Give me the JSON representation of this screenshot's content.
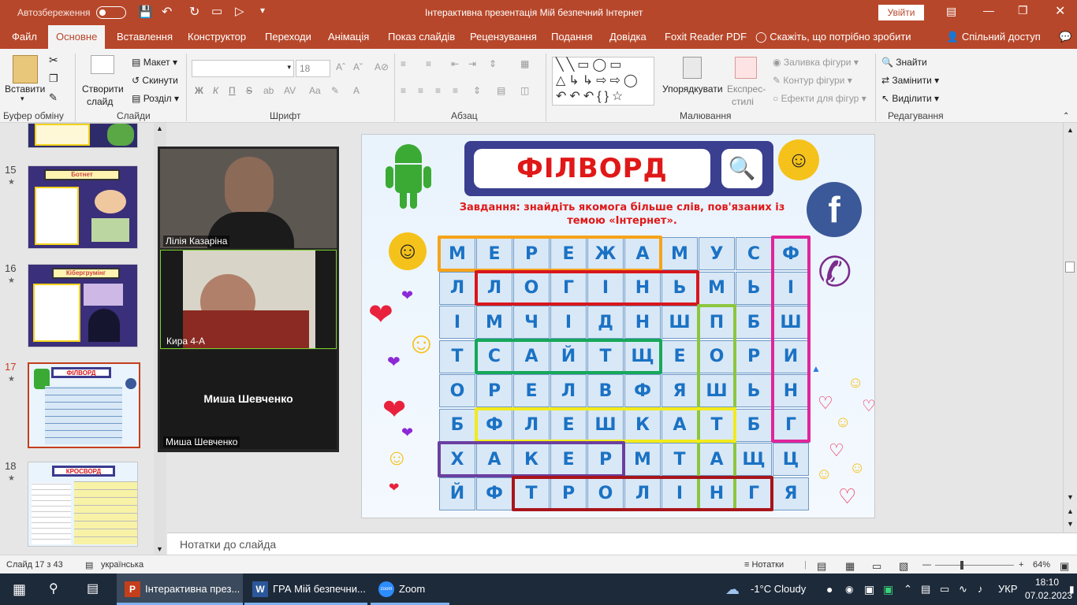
{
  "titlebar": {
    "autosave": "Автозбереження",
    "title": "Інтерактивна презентація Мій безпечний Інтернет",
    "signin": "Увійти"
  },
  "tabs": [
    "Файл",
    "Основне",
    "Вставлення",
    "Конструктор",
    "Переходи",
    "Анімація",
    "Показ слайдів",
    "Рецензування",
    "Подання",
    "Довідка",
    "Foxit Reader PDF"
  ],
  "tell_me": "Скажіть, що потрібно зробити",
  "share": "Спільний доступ",
  "ribbon": {
    "paste": "Вставити",
    "clipboard": "Буфер обміну",
    "new_slide": "Створити",
    "new_slide2": "слайд",
    "layout": "Макет",
    "reset": "Скинути",
    "section": "Розділ",
    "slides": "Слайди",
    "font_size": "18",
    "font": "Шрифт",
    "bold": "Ж",
    "italic": "К",
    "underline": "П",
    "strike": "S",
    "paragraph": "Абзац",
    "arrange": "Упорядкувати",
    "quick_styles": "Експрес-",
    "quick_styles2": "стилі",
    "fill": "Заливка фігури",
    "outline": "Контур фігури",
    "effects": "Ефекти для фігур",
    "drawing": "Малювання",
    "find": "Знайти",
    "replace": "Замінити",
    "select": "Виділити",
    "editing": "Редагування"
  },
  "thumbnails": [
    {
      "num": "15",
      "title": "Ботнет"
    },
    {
      "num": "16",
      "title": "Кібергрумінг"
    },
    {
      "num": "17",
      "title": "ФІЛВОРД"
    },
    {
      "num": "18",
      "title": "КРОСВОРД"
    }
  ],
  "zoom": {
    "participants": [
      {
        "name": "Лілія Казаріна"
      },
      {
        "name": "Кира 4-А"
      },
      {
        "name": "Миша Шевченко",
        "big": "Миша Шевченко"
      }
    ]
  },
  "slide": {
    "title": "ФІЛВОРД",
    "task": "Завдання: знайдіть якомога більше слів, пов'язаних із темою «Інтернет».",
    "task_line1": "Завдання: знайдіть якомога більше слів, пов'язаних із",
    "task_line2": "темою  «Інтернет».",
    "grid": [
      [
        "М",
        "Е",
        "Р",
        "Е",
        "Ж",
        "А",
        "М",
        "У",
        "С",
        "Ф"
      ],
      [
        "Л",
        "Л",
        "О",
        "Г",
        "І",
        "Н",
        "Ь",
        "М",
        "Ь",
        "І"
      ],
      [
        "І",
        "М",
        "Ч",
        "І",
        "Д",
        "Н",
        "Ш",
        "П",
        "Б",
        "Ш"
      ],
      [
        "Т",
        "С",
        "А",
        "Й",
        "Т",
        "Щ",
        "Е",
        "О",
        "Р",
        "И"
      ],
      [
        "О",
        "Р",
        "Е",
        "Л",
        "В",
        "Ф",
        "Я",
        "Ш",
        "Ь",
        "Н"
      ],
      [
        "Б",
        "Ф",
        "Л",
        "Е",
        "Ш",
        "К",
        "А",
        "Т",
        "Б",
        "Г"
      ],
      [
        "Х",
        "А",
        "К",
        "Е",
        "Р",
        "М",
        "Т",
        "А",
        "Щ",
        "Ц"
      ],
      [
        "Й",
        "Ф",
        "Т",
        "Р",
        "О",
        "Л",
        "І",
        "Н",
        "Г",
        "Я"
      ]
    ],
    "highlight_colors": {
      "orange": "#f5a31a",
      "red": "#d8161c",
      "green": "#16a85a",
      "lime": "#8cc63e",
      "magenta": "#e0259a",
      "yellow": "#f2ea1c",
      "purple": "#6b3fa0",
      "darkred": "#a8151b"
    }
  },
  "notes": "Нотатки до слайда",
  "status": {
    "slide": "Слайд 17 з 43",
    "lang": "українська",
    "notes": "Нотатки",
    "zoom": "64%"
  },
  "taskbar": {
    "app1": "Інтерактивна през...",
    "app2": "ГРА Мій безпечни...",
    "app3": "Zoom",
    "weather": "-1°C  Cloudy",
    "lang": "УКР",
    "time": "18:10",
    "date": "07.02.2023"
  }
}
